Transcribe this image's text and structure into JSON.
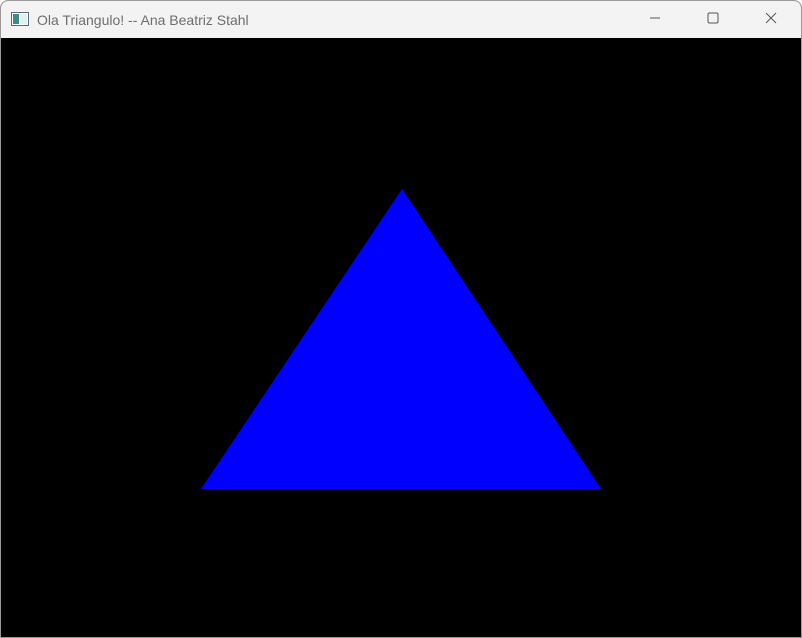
{
  "window": {
    "title": "Ola Triangulo! -- Ana Beatriz Stahl",
    "icon": "app-window-icon",
    "controls": {
      "minimize_icon": "minimize-icon",
      "maximize_icon": "maximize-icon",
      "close_icon": "close-icon"
    }
  },
  "scene": {
    "background_color": "#000000",
    "shape": "triangle",
    "fill_color": "#0000ff"
  }
}
